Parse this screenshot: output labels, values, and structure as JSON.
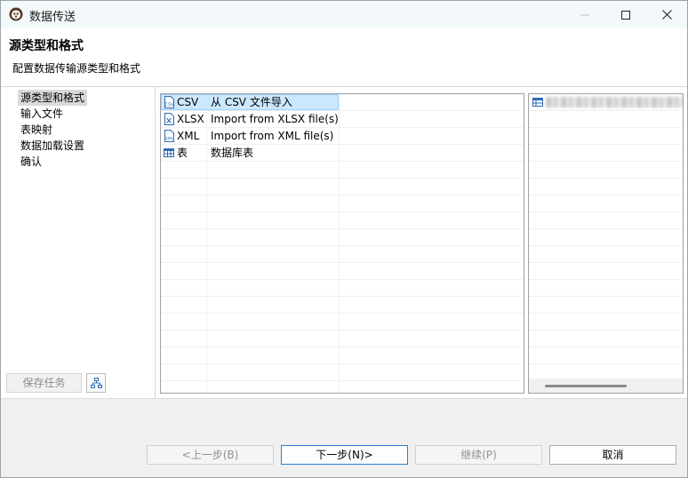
{
  "window": {
    "title": "数据传送"
  },
  "header": {
    "title": "源类型和格式",
    "description": "配置数据传输源类型和格式"
  },
  "nav": {
    "items": [
      {
        "label": "源类型和格式",
        "selected": true
      },
      {
        "label": "输入文件",
        "selected": false
      },
      {
        "label": "表映射",
        "selected": false
      },
      {
        "label": "数据加载设置",
        "selected": false
      },
      {
        "label": "确认",
        "selected": false
      }
    ],
    "save_task_label": "保存任务"
  },
  "source_types": [
    {
      "type": "CSV",
      "description": "从 CSV 文件导入",
      "icon": "csv-file-icon",
      "selected": true
    },
    {
      "type": "XLSX",
      "description": "Import from XLSX file(s)",
      "icon": "xlsx-file-icon",
      "selected": false
    },
    {
      "type": "XML",
      "description": "Import from XML file(s)",
      "icon": "xml-file-icon",
      "selected": false
    },
    {
      "type": "表",
      "description": "数据库表",
      "icon": "table-icon",
      "selected": false
    }
  ],
  "buttons": {
    "back": "<上一步(B)",
    "next": "下一步(N)>",
    "continue": "继续(P)",
    "cancel": "取消"
  },
  "colors": {
    "selection": "#cce8ff",
    "selection_border": "#99d1ff",
    "primary_border": "#2b7cd3"
  }
}
